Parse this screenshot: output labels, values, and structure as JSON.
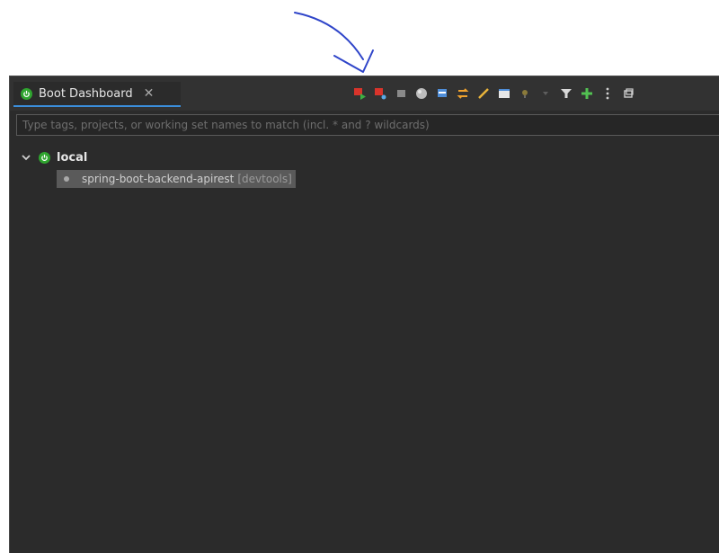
{
  "view": {
    "tab_title": "Boot Dashboard",
    "close_glyph": "✕"
  },
  "toolbar": {
    "icons": [
      "start-icon",
      "debug-icon",
      "stop-icon",
      "open-browser-icon",
      "console-icon",
      "refresh-icon",
      "edit-icon",
      "properties-icon",
      "dropdown-icon",
      "filter-icon",
      "add-icon",
      "view-menu-icon",
      "restore-icon"
    ]
  },
  "filter": {
    "placeholder": "Type tags, projects, or working set names to match (incl. * and ? wildcards)",
    "value": ""
  },
  "tree": {
    "expand_glyph": "⌄",
    "root_label": "local",
    "child_label": "spring-boot-backend-apirest",
    "child_tag": "[devtools]"
  },
  "colors": {
    "panel_bg": "#2b2b2b",
    "accent": "#3b8edb",
    "boot_green": "#2fa52f",
    "annotation": "#2f45c9"
  }
}
